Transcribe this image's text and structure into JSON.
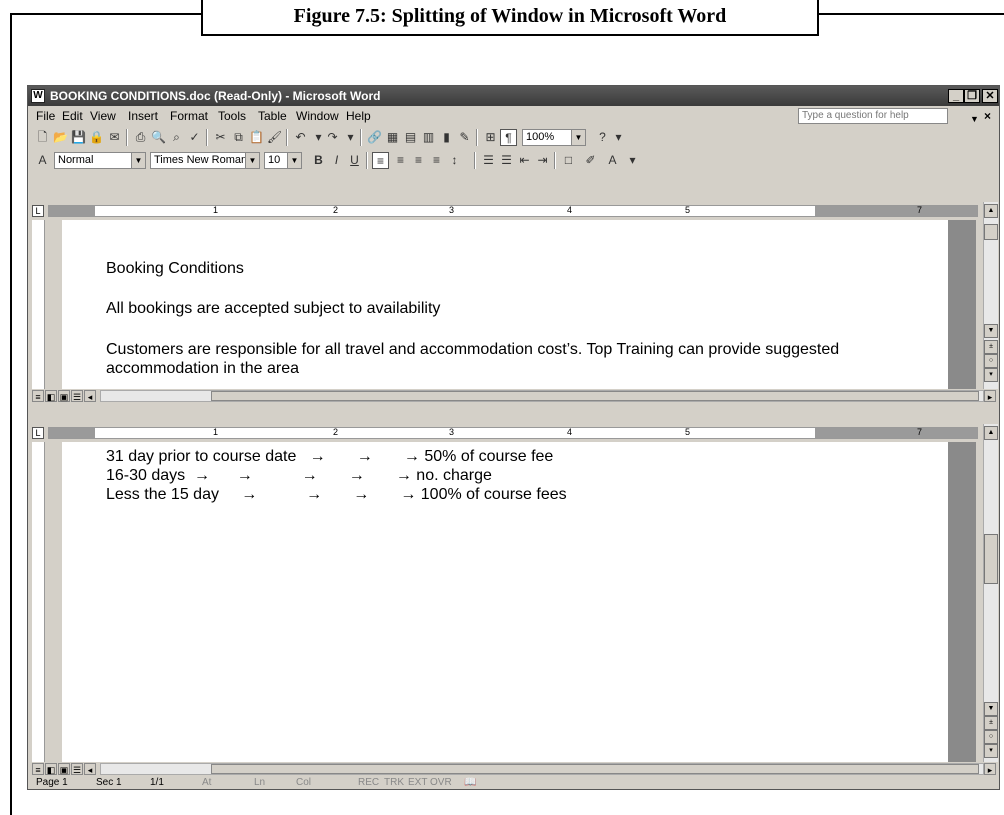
{
  "caption": "Figure 7.5: Splitting of Window in Microsoft Word",
  "window": {
    "title": "BOOKING CONDITIONS.doc (Read-Only) - Microsoft Word",
    "controls": {
      "minimize": "_",
      "restore": "❐",
      "close": "✕"
    }
  },
  "menu": {
    "items": [
      "File",
      "Edit",
      "View",
      "Insert",
      "Format",
      "Tools",
      "Table",
      "Window",
      "Help"
    ],
    "help_placeholder": "Type a question for help",
    "close_doc": "×"
  },
  "formatting": {
    "style": "Normal",
    "font": "Times New Roman",
    "size": "10",
    "zoom": "100%",
    "bold": "B",
    "italic": "I",
    "underline": "U"
  },
  "ruler_numbers": [
    "1",
    "2",
    "3",
    "4",
    "5",
    "7"
  ],
  "pane_top": {
    "lines": [
      "Booking Conditions",
      "All bookings are accepted subject to availability",
      "Customers are responsible for all travel and accommodation cost’s. Top Training can provide suggested",
      "accommodation in the area"
    ]
  },
  "pane_bottom": {
    "lines": [
      "31 day prior to course date   →       →       → 50% of course fee",
      "16-30 days  →      →           →       →       → no. charge",
      "Less the 15 day     →           →       →       → 100% of course fees"
    ]
  },
  "status": {
    "page": "Page 1",
    "sec": "Sec 1",
    "pages": "1/1",
    "at": "At",
    "ln": "Ln",
    "col": "Col",
    "rec": "REC",
    "trk": "TRK",
    "ext": "EXT",
    "ovr": "OVR"
  }
}
